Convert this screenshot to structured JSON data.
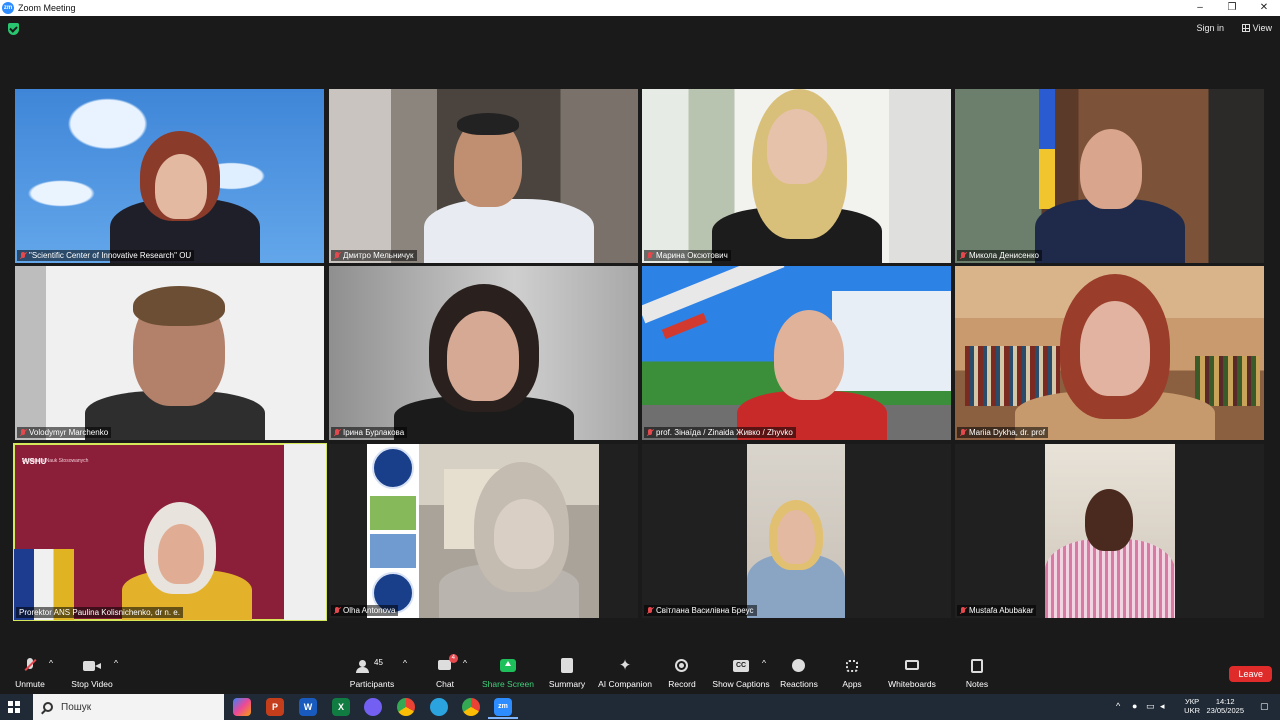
{
  "window": {
    "title": "Zoom Meeting",
    "app_icon": "zm",
    "controls": [
      "–",
      "❐",
      "✕"
    ]
  },
  "header": {
    "sign_in": "Sign in",
    "view": "View"
  },
  "participants_tiles": [
    {
      "name": "\"Scientific Center of Innovative Research\" OU"
    },
    {
      "name": "Дмитро Мельничук"
    },
    {
      "name": "Марина Оксютович"
    },
    {
      "name": "Микола Денисенко"
    },
    {
      "name": "Volodymyr Marchenko"
    },
    {
      "name": "Ірина  Бурлакова"
    },
    {
      "name": "prof. Зінаїда / Zinaida Живко / Zhyvko"
    },
    {
      "name": "Mariia Dykha, dr. prof"
    },
    {
      "name": "Prorektor ANS Paulina Kolisnichenko, dr n. e."
    },
    {
      "name": "Olha Antonova"
    },
    {
      "name": "Світлана Василівна Бреус"
    },
    {
      "name": "Mustafa Abubakar"
    }
  ],
  "backdrop_text": {
    "logo": "WSHU",
    "tagline": "Akademia Nauk Stosowanych"
  },
  "toolbar": {
    "unmute": "Unmute",
    "stop_video": "Stop Video",
    "participants": "Participants",
    "participants_count": "45",
    "chat": "Chat",
    "chat_badge": "4",
    "share_screen": "Share Screen",
    "summary": "Summary",
    "ai_companion": "AI Companion",
    "record": "Record",
    "show_captions": "Show Captions",
    "reactions": "Reactions",
    "apps": "Apps",
    "whiteboards": "Whiteboards",
    "notes": "Notes",
    "leave": "Leave"
  },
  "taskbar": {
    "search_placeholder": "Пошук",
    "lang_top": "УКР",
    "lang_bottom": "UKR",
    "time": "14:12",
    "date": "23/05/2025",
    "apps": [
      "copilot",
      "powerpoint",
      "word",
      "excel",
      "viber",
      "chrome",
      "telegram",
      "chrome",
      "zoom"
    ],
    "app_letters": {
      "powerpoint": "P",
      "word": "W",
      "excel": "X",
      "zoom": "zm"
    }
  },
  "colors": {
    "zoom_blue": "#2d8cff",
    "leave_red": "#e02b2b",
    "share_green": "#1ec05b",
    "active_speaker": "#d6e85a"
  }
}
